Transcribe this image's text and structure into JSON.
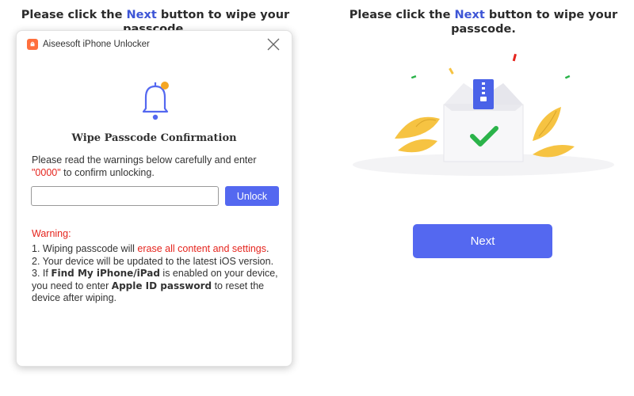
{
  "instruction": {
    "prefix": "Please click the",
    "highlight": "Next",
    "suffix": "button to wipe your passcode."
  },
  "dialog": {
    "app_icon": "lock-icon",
    "app_title": "Aiseesoft iPhone Unlocker",
    "close_icon": "close-icon",
    "bell_icon": "bell-icon",
    "title": "Wipe Passcode Confirmation",
    "instructions_prefix": "Please read the warnings below carefully and enter",
    "instructions_code": "\"0000\"",
    "instructions_suffix": "to confirm unlocking.",
    "input_value": "",
    "unlock_label": "Unlock",
    "warning_label": "Warning:",
    "warnings": {
      "w1_prefix": "1. Wiping passcode will",
      "w1_red": "erase all content and settings",
      "w1_suffix": ".",
      "w2": "2. Your device will be updated to the latest iOS version.",
      "w3_prefix": "3. If",
      "w3_bold1": "Find My iPhone/iPad",
      "w3_mid": "is enabled on your device, you need to enter",
      "w3_bold2": "Apple ID password",
      "w3_suffix": "to reset the device after wiping."
    }
  },
  "right_panel": {
    "illustration_icon": "box-checkmark-icon",
    "next_label": "Next"
  },
  "colors": {
    "accent": "#5468f0",
    "highlight_text": "#3d55d6",
    "warning_red": "#e5241d",
    "bell_dot": "#f5a623",
    "check_green": "#2bb34a",
    "leaf_yellow": "#f6c342"
  }
}
